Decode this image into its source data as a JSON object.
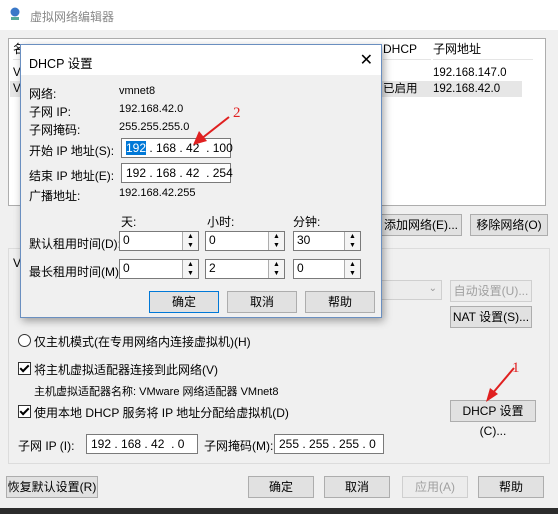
{
  "window": {
    "title": "虚拟网络编辑器"
  },
  "list": {
    "headers": [
      "名",
      "DHCP",
      "子网地址"
    ],
    "rows": [
      {
        "name": "V",
        "dhcp": "",
        "subnet": "192.168.147.0"
      },
      {
        "name": "V",
        "dhcp": "已启用",
        "subnet": "192.168.42.0"
      }
    ]
  },
  "list_buttons": {
    "add": "添加网络(E)...",
    "remove": "移除网络(O)"
  },
  "vmnet": {
    "auto_label": "自动设置(U)...",
    "nat_label": "NAT 设置(S)...",
    "host_only_label": "仅主机模式(在专用网络内连接虚拟机)(H)",
    "connect_label": "将主机虚拟适配器连接到此网络(V)",
    "adapter_label": "主机虚拟适配器名称: VMware 网络适配器 VMnet8",
    "dhcp_label": "使用本地 DHCP 服务将 IP 地址分配给虚拟机(D)",
    "dhcp_button": "DHCP 设置(C)...",
    "subnet_ip_label": "子网 IP (I):",
    "subnet_ip": "192 . 168 . 42  . 0",
    "mask_label": "子网掩码(M):",
    "mask": "255 . 255 . 255 . 0",
    "w_stub1": "V",
    "w_stub2": "V"
  },
  "bottom_buttons": {
    "restore": "恢复默认设置(R)",
    "ok": "确定",
    "cancel": "取消",
    "apply": "应用(A)",
    "help": "帮助"
  },
  "dhcp_dialog": {
    "title": "DHCP 设置",
    "close": "✕",
    "network_label": "网络:",
    "network_value": "vmnet8",
    "subnet_ip_label": "子网 IP:",
    "subnet_ip_value": "192.168.42.0",
    "mask_label": "子网掩码:",
    "mask_value": "255.255.255.0",
    "start_label": "开始 IP 地址(S):",
    "start_sel": "192",
    "start_rest": " . 168 . 42  . 100",
    "end_label": "结束 IP 地址(E):",
    "end_value": "192 . 168 . 42  . 254",
    "broadcast_label": "广播地址:",
    "broadcast_value": "192.168.42.255",
    "col_days": "天:",
    "col_hours": "小时:",
    "col_minutes": "分钟:",
    "default_lease_label": "默认租用时间(D):",
    "default_lease": {
      "days": "0",
      "hours": "0",
      "minutes": "30"
    },
    "max_lease_label": "最长租用时间(M):",
    "max_lease": {
      "days": "0",
      "hours": "2",
      "minutes": "0"
    },
    "ok": "确定",
    "cancel": "取消",
    "help": "帮助"
  },
  "annotations": {
    "one": "1",
    "two": "2"
  },
  "colors": {
    "annotation": "#e02020",
    "accent": "#0078d7"
  }
}
